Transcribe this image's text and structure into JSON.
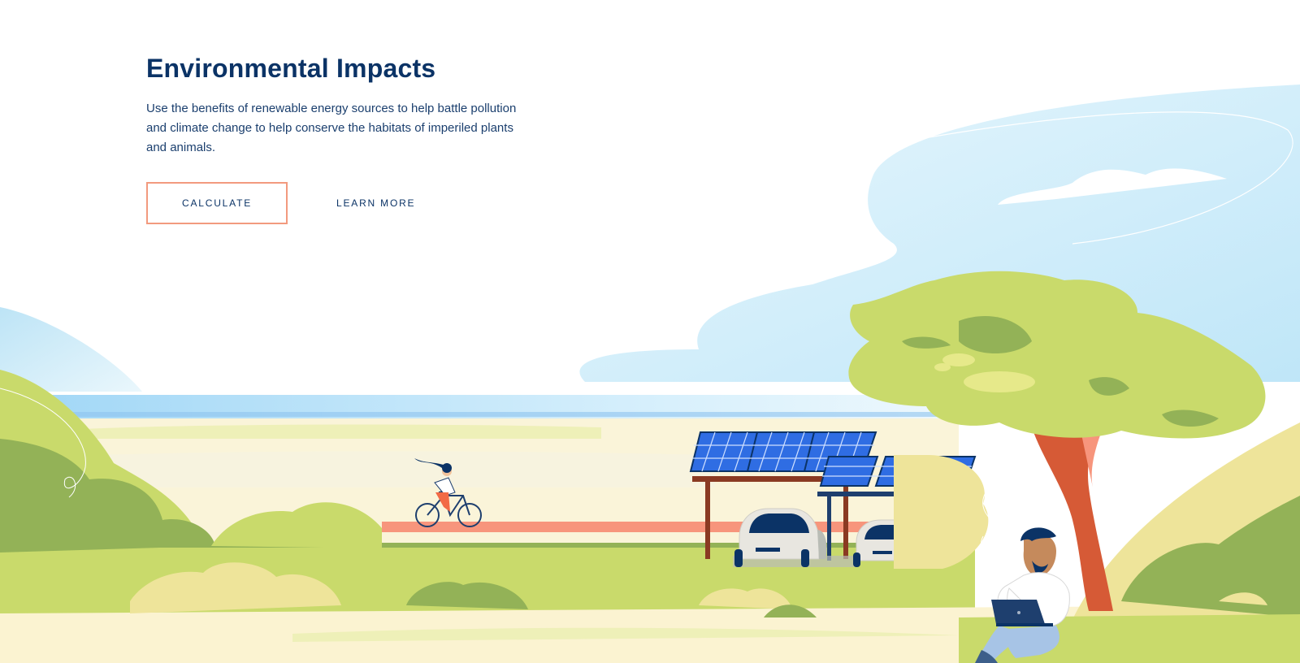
{
  "hero": {
    "title": "Environmental Impacts",
    "description": "Use the benefits of renewable energy sources to help battle pollution and climate change to help conserve the habitats of imperiled plants and animals.",
    "calculate_label": "CALCULATE",
    "learn_more_label": "LEARN MORE"
  },
  "colors": {
    "title": "#0b3366",
    "accent_border": "#f29a7e",
    "sky": "#cdeefb",
    "sea": "#9fd6f6",
    "grass": "#c9da6b",
    "dark_grass": "#93b257",
    "sand": "#faf4d9",
    "path": "#f7957c",
    "trunk": "#d65a36",
    "panel": "#2f6de3"
  },
  "illustration": {
    "scene": "renewable-energy-landscape",
    "icons": [
      "cyclist-icon",
      "solar-carport-icon",
      "car-icon",
      "tree-icon",
      "person-with-laptop-icon",
      "cloud-icon"
    ]
  }
}
